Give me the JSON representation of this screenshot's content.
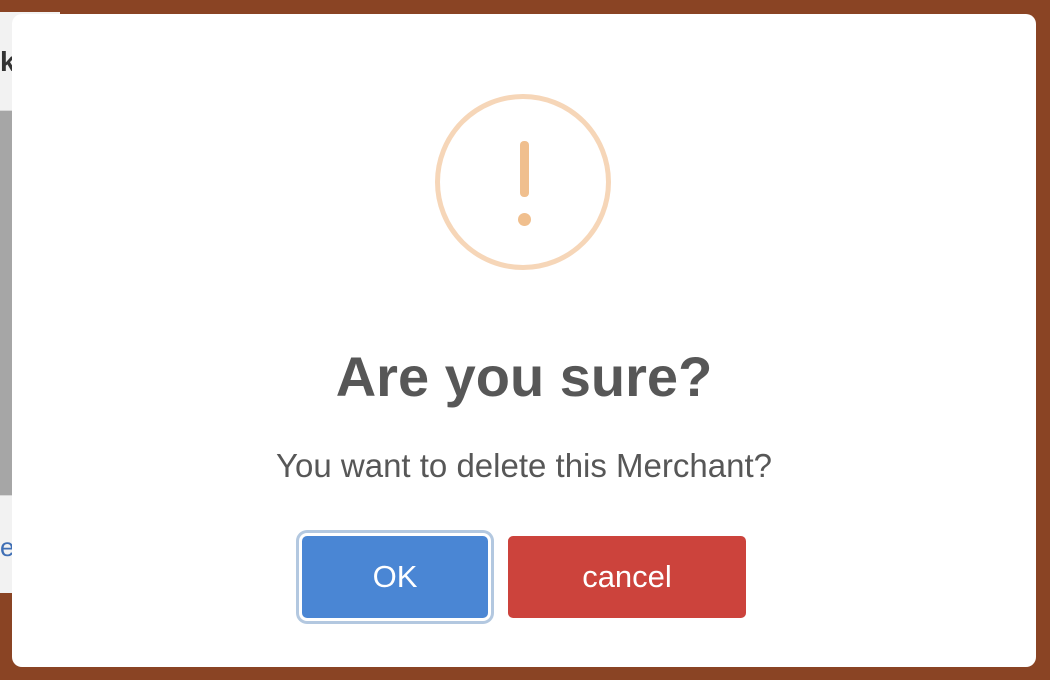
{
  "background_page": {
    "header_fragment": "k",
    "footer_fragment": "e"
  },
  "dialog": {
    "icon": "exclamation-warning-icon",
    "title": "Are you sure?",
    "message": "You want to delete this Merchant?",
    "confirm_label": "OK",
    "cancel_label": "cancel",
    "colors": {
      "icon_ring": "#f6d6b8",
      "icon_mark": "#f0bf8e",
      "confirm": "#4a86d4",
      "cancel": "#cc433c",
      "backdrop": "#8a4424"
    }
  }
}
